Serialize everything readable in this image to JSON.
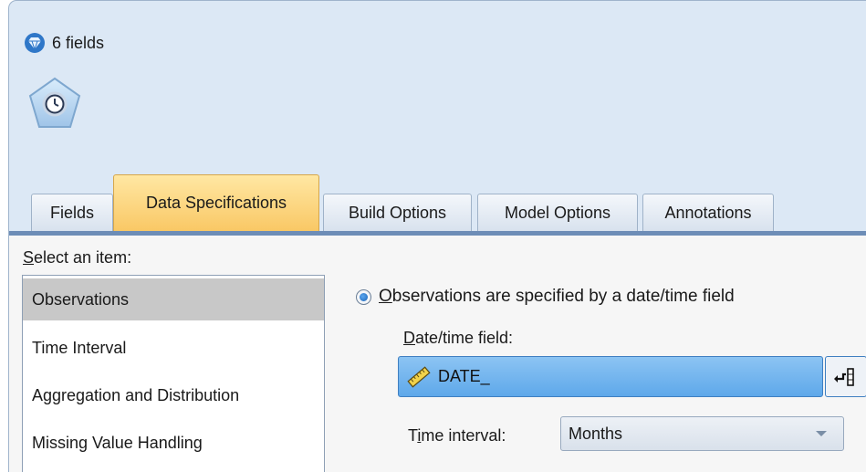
{
  "window": {
    "title": "6 fields",
    "title_icon": "diamond-icon",
    "node_icon": "clock-node-icon"
  },
  "tabs": [
    {
      "label": "Fields",
      "active": false
    },
    {
      "label": "Data Specifications",
      "active": true
    },
    {
      "label": "Build Options",
      "active": false
    },
    {
      "label": "Model Options",
      "active": false
    },
    {
      "label": "Annotations",
      "active": false
    }
  ],
  "left": {
    "select_label_mnemonic": "S",
    "select_label_rest": "elect an item:",
    "items": [
      {
        "label": "Observations",
        "selected": true
      },
      {
        "label": "Time Interval",
        "selected": false
      },
      {
        "label": "Aggregation and Distribution",
        "selected": false
      },
      {
        "label": "Missing Value Handling",
        "selected": false
      }
    ]
  },
  "right": {
    "radio_label_mnemonic": "O",
    "radio_label_rest": "bservations are specified by a date/time field",
    "radio_checked": true,
    "date_field_label_mnemonic": "D",
    "date_field_label_rest": "ate/time field:",
    "date_field_value": "DATE_",
    "date_field_icon": "ruler-icon",
    "picker_icon": "field-picker-icon",
    "time_interval_label_pre": "T",
    "time_interval_label_mnemonic": "i",
    "time_interval_label_rest": "me interval:",
    "time_interval_value": "Months"
  },
  "colors": {
    "active_tab": "#f9c865",
    "field_box": "#6fb2ee",
    "tab_underline": "#6d8db7",
    "selected_item": "#c8c8c8"
  }
}
